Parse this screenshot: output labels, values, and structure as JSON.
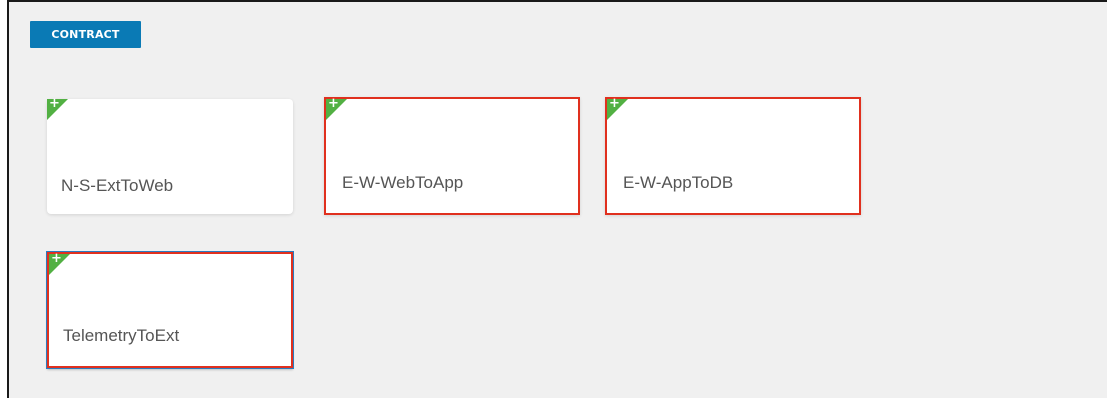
{
  "section": {
    "badge_label": "CONTRACT"
  },
  "icons": {
    "add": "+"
  },
  "colors": {
    "badge_bg": "#0a7ab5",
    "corner_green": "#52b043",
    "highlight_red": "#e0301e",
    "selected_blue": "#2a7bbf"
  },
  "contracts": [
    {
      "name": "N-S-ExtToWeb",
      "highlighted": false,
      "selected": false
    },
    {
      "name": "E-W-WebToApp",
      "highlighted": true,
      "selected": false
    },
    {
      "name": "E-W-AppToDB",
      "highlighted": true,
      "selected": false
    },
    {
      "name": "TelemetryToExt",
      "highlighted": true,
      "selected": true
    }
  ]
}
